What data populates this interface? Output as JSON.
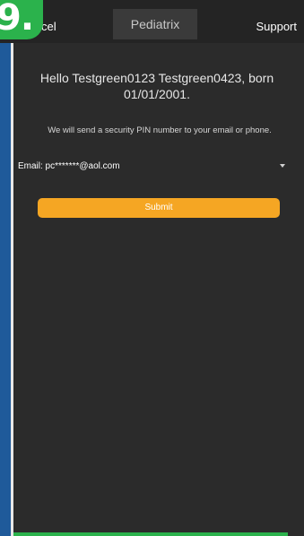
{
  "step": {
    "label": "9."
  },
  "header": {
    "cancel_label": "cel",
    "title": "Pediatrix",
    "support_label": "Support"
  },
  "main": {
    "greeting": "Hello Testgreen0123 Testgreen0423, born 01/01/2001.",
    "pin_note": "We will send a security PIN number to your email or phone.",
    "email_option": "Email: pc*******@aol.com",
    "submit_label": "Submit"
  },
  "colors": {
    "accent": "#f5a623",
    "badge": "#2bb24c",
    "stripe": "#1f5a9a"
  }
}
